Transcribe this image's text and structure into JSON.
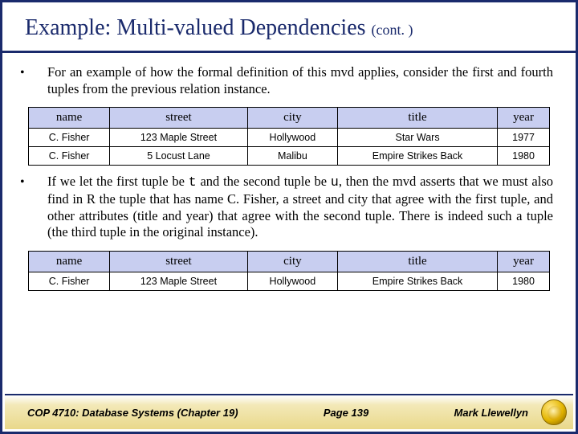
{
  "title_main": "Example: Multi-valued Dependencies ",
  "title_cont": "(cont. )",
  "bullet1": "For an example of how the formal definition of this mvd applies, consider the first and fourth tuples from the previous relation instance.",
  "bullet2_pre": "If we let the first tuple be ",
  "bullet2_t": "t",
  "bullet2_mid1": " and the second tuple be ",
  "bullet2_u": "u",
  "bullet2_post": ", then the mvd asserts that we must also find in R the tuple that has name C. Fisher, a street and city that agree with the first tuple, and other attributes (title and year) that agree with the second tuple.  There is indeed such a tuple (the third tuple in the original instance).",
  "headers": {
    "c0": "name",
    "c1": "street",
    "c2": "city",
    "c3": "title",
    "c4": "year"
  },
  "t1": {
    "r0": {
      "c0": "C. Fisher",
      "c1": "123 Maple Street",
      "c2": "Hollywood",
      "c3": "Star Wars",
      "c4": "1977"
    },
    "r1": {
      "c0": "C. Fisher",
      "c1": "5 Locust Lane",
      "c2": "Malibu",
      "c3": "Empire Strikes Back",
      "c4": "1980"
    }
  },
  "t2": {
    "r0": {
      "c0": "C. Fisher",
      "c1": "123 Maple Street",
      "c2": "Hollywood",
      "c3": "Empire Strikes Back",
      "c4": "1980"
    }
  },
  "footer": {
    "left": "COP 4710: Database Systems  (Chapter 19)",
    "center": "Page 139",
    "right": "Mark Llewellyn"
  }
}
